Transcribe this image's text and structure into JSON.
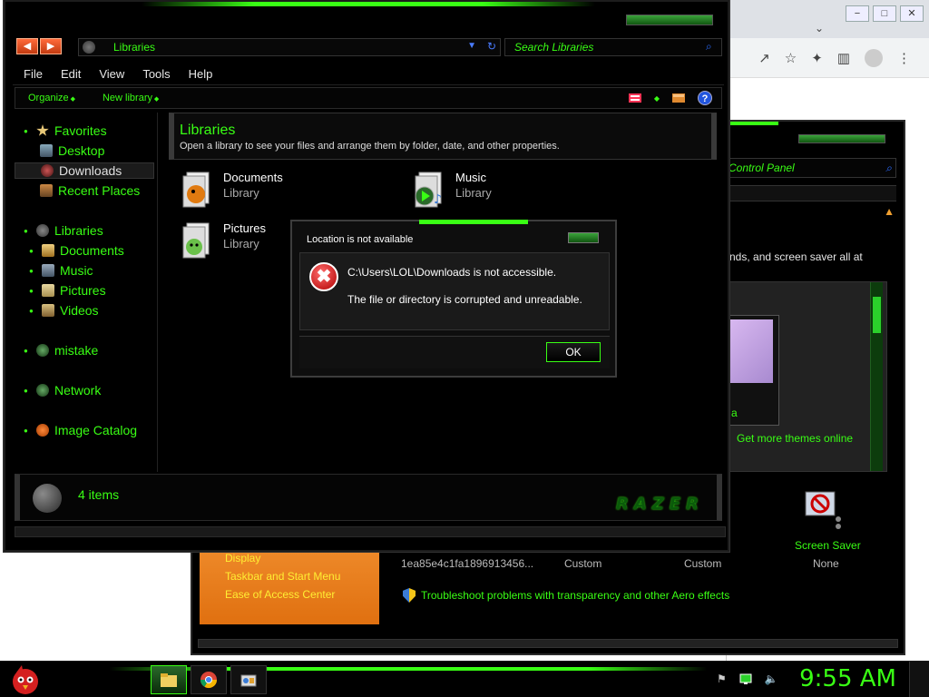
{
  "browser": {
    "buttons": {
      "minimize": "−",
      "maximize": "□",
      "close": "✕"
    },
    "chevron": "⌄",
    "toolbar_icons": [
      "share-icon",
      "star-icon",
      "extensions-icon",
      "sidebar-icon",
      "profile-icon",
      "menu-icon"
    ],
    "toolbar_glyphs": {
      "share": "↗",
      "star": "☆",
      "ext": "✦",
      "side": "▥",
      "menu": "⋮"
    }
  },
  "control_panel": {
    "address": "Control Panel",
    "description": "nds, and screen saver all at",
    "get_more_themes": "Get more themes online",
    "theme_thumb_caption": "a",
    "left_links": [
      "Display",
      "Taskbar and Start Menu",
      "Ease of Access Center"
    ],
    "theme_hash": "1ea85e4c1fa1896913456...",
    "desktop_bg_value": "Custom",
    "color_value": "Custom",
    "screen_saver_label": "Screen Saver",
    "screen_saver_value": "None",
    "troubleshoot": "Troubleshoot problems with transparency and other Aero effects"
  },
  "explorer": {
    "nav_back": "◀",
    "nav_forward": "▶",
    "address_path": "Libraries",
    "search_placeholder": "Search Libraries",
    "menu": [
      "File",
      "Edit",
      "View",
      "Tools",
      "Help"
    ],
    "commands": [
      "Organize",
      "New library"
    ],
    "help_glyph": "?",
    "nav_pane": {
      "favorites": "Favorites",
      "desktop": "Desktop",
      "downloads": "Downloads",
      "recent_places": "Recent Places",
      "libraries": "Libraries",
      "documents": "Documents",
      "music": "Music",
      "pictures": "Pictures",
      "videos": "Videos",
      "homegroup": "mistake",
      "network": "Network",
      "image_catalog": "Image Catalog"
    },
    "header": {
      "title": "Libraries",
      "subtitle": "Open a library to see your files and arrange them by folder, date, and other properties."
    },
    "libraries": [
      {
        "name": "Documents",
        "type": "Library"
      },
      {
        "name": "Music",
        "type": "Library"
      },
      {
        "name": "Pictures",
        "type": "Library"
      }
    ],
    "details": {
      "count": "4 items",
      "brand": "RAZER"
    }
  },
  "dialog": {
    "title": "Location is not available",
    "message_line1": "C:\\Users\\LOL\\Downloads is not accessible.",
    "message_line2": "The file or directory is corrupted and unreadable.",
    "ok_label": "OK",
    "error_glyph": "✖"
  },
  "taskbar": {
    "clock": "9:55 AM",
    "tray_icons": [
      "action-center-icon",
      "network-icon",
      "volume-icon"
    ],
    "tray_glyphs": {
      "flag": "⚑",
      "volume": "🔈"
    }
  },
  "colors": {
    "accent": "#39ff14",
    "background": "#000000",
    "dialog_error": "#b00000",
    "panel_orange": "#e07010"
  }
}
